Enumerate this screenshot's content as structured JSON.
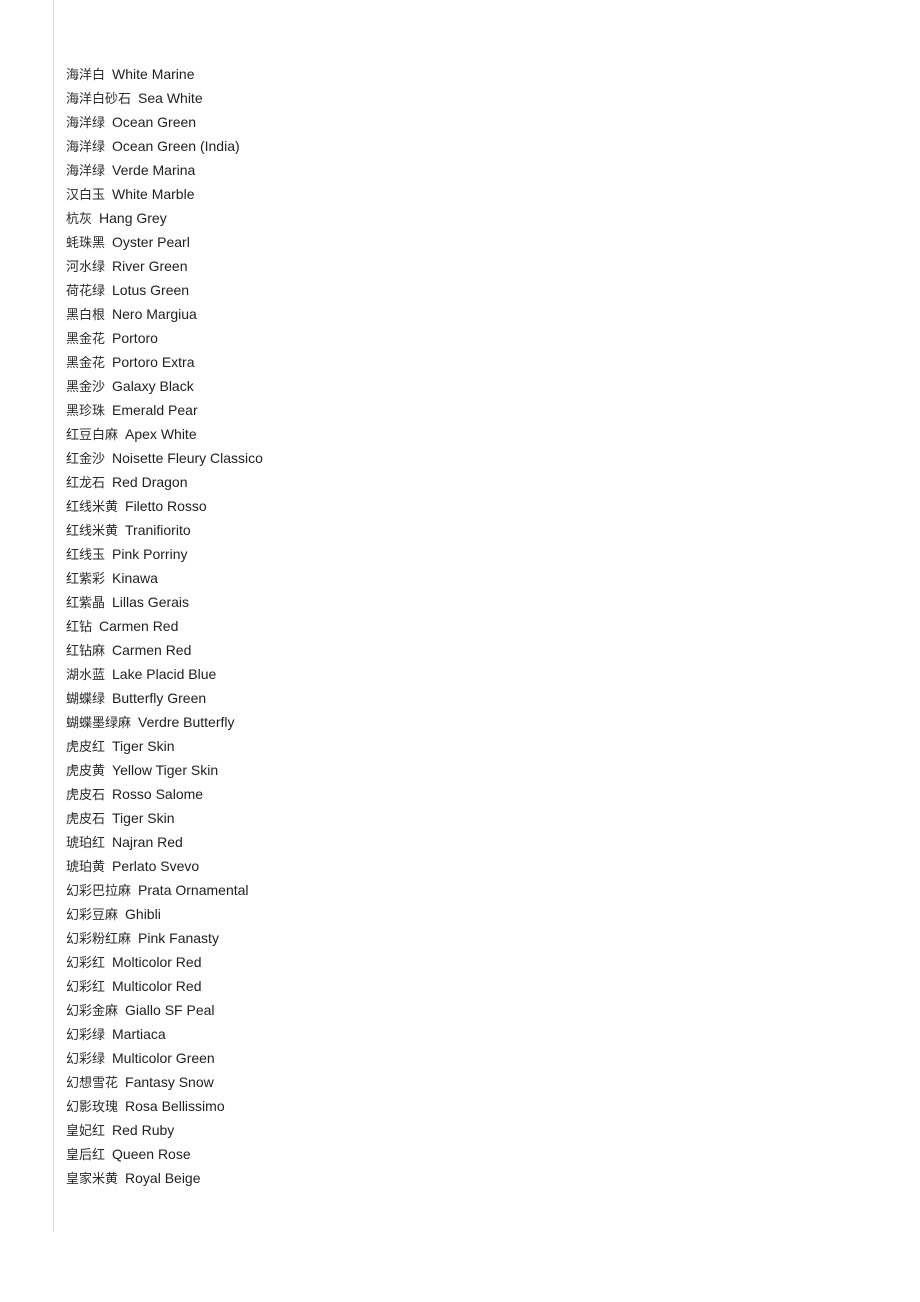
{
  "document": {
    "background_color": "#ffffff",
    "text_color": "#252525",
    "rule_color": "#d8d8d8"
  },
  "list": {
    "columns": [
      "chinese_name",
      "english_name"
    ],
    "rows": [
      {
        "cn": "海洋白",
        "en": "White Marine"
      },
      {
        "cn": "海洋白砂石",
        "en": "Sea White"
      },
      {
        "cn": "海洋绿",
        "en": "Ocean Green"
      },
      {
        "cn": "海洋绿",
        "en": "Ocean Green (India)"
      },
      {
        "cn": "海洋绿",
        "en": "Verde Marina"
      },
      {
        "cn": "汉白玉",
        "en": "White Marble"
      },
      {
        "cn": "杭灰",
        "en": "Hang Grey"
      },
      {
        "cn": "蚝珠黑",
        "en": "Oyster Pearl"
      },
      {
        "cn": "河水绿",
        "en": "River Green"
      },
      {
        "cn": "荷花绿",
        "en": "Lotus Green"
      },
      {
        "cn": "黑白根",
        "en": "Nero Margiua"
      },
      {
        "cn": "黑金花",
        "en": "Portoro"
      },
      {
        "cn": "黑金花",
        "en": "Portoro Extra"
      },
      {
        "cn": "黑金沙",
        "en": "Galaxy Black"
      },
      {
        "cn": "黑珍珠",
        "en": "Emerald Pear"
      },
      {
        "cn": "红豆白麻",
        "en": "Apex White"
      },
      {
        "cn": "红金沙",
        "en": "Noisette Fleury Classico"
      },
      {
        "cn": "红龙石",
        "en": "Red Dragon"
      },
      {
        "cn": "红线米黄",
        "en": "Filetto Rosso"
      },
      {
        "cn": "红线米黄",
        "en": "Tranifiorito"
      },
      {
        "cn": "红线玉",
        "en": "Pink Porriny"
      },
      {
        "cn": "红紫彩",
        "en": "Kinawa"
      },
      {
        "cn": "红紫晶",
        "en": "Lillas Gerais"
      },
      {
        "cn": "红钻",
        "en": "Carmen Red"
      },
      {
        "cn": "红钻麻",
        "en": "Carmen Red"
      },
      {
        "cn": "湖水蓝",
        "en": "Lake Placid Blue"
      },
      {
        "cn": "蝴蝶绿",
        "en": "Butterfly Green"
      },
      {
        "cn": "蝴蝶墨绿麻",
        "en": "Verdre Butterfly"
      },
      {
        "cn": "虎皮红",
        "en": "Tiger Skin"
      },
      {
        "cn": "虎皮黄",
        "en": "Yellow Tiger Skin"
      },
      {
        "cn": "虎皮石",
        "en": "Rosso Salome"
      },
      {
        "cn": "虎皮石",
        "en": "Tiger Skin"
      },
      {
        "cn": "琥珀红",
        "en": "Najran Red"
      },
      {
        "cn": "琥珀黄",
        "en": "Perlato Svevo"
      },
      {
        "cn": "幻彩巴拉麻",
        "en": "Prata Ornamental"
      },
      {
        "cn": "幻彩豆麻",
        "en": "Ghibli"
      },
      {
        "cn": "幻彩粉红麻",
        "en": "Pink Fanasty"
      },
      {
        "cn": "幻彩红",
        "en": "Molticolor Red"
      },
      {
        "cn": "幻彩红",
        "en": "Multicolor Red"
      },
      {
        "cn": "幻彩金麻",
        "en": "Giallo SF Peal"
      },
      {
        "cn": "幻彩绿",
        "en": "Martiaca"
      },
      {
        "cn": "幻彩绿",
        "en": "Multicolor Green"
      },
      {
        "cn": "幻想雪花",
        "en": "Fantasy Snow"
      },
      {
        "cn": "幻影玫瑰",
        "en": "Rosa Bellissimo"
      },
      {
        "cn": "皇妃红",
        "en": "Red Ruby"
      },
      {
        "cn": "皇后红",
        "en": "Queen Rose"
      },
      {
        "cn": "皇家米黄",
        "en": "Royal Beige"
      }
    ]
  }
}
